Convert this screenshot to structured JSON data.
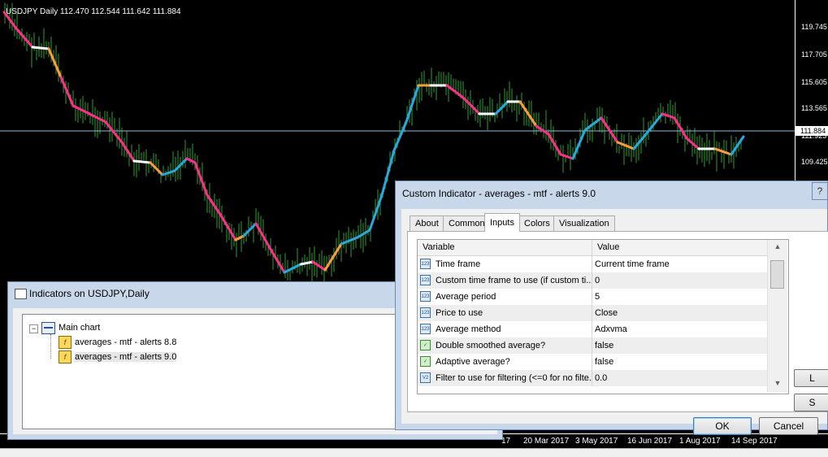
{
  "chart": {
    "title": "USDJPY Daily  112.470 112.544 111.642 111.884",
    "price_ticks": [
      "119.745",
      "117.705",
      "115.605",
      "113.565",
      "111.925",
      "109.425"
    ],
    "current_price": "111.884",
    "date_ticks": [
      "17",
      "20 Mar 2017",
      "3 May 2017",
      "16 Jun 2017",
      "1 Aug 2017",
      "14 Sep 2017"
    ],
    "colors": {
      "bars": "#2e9e2e",
      "ma_up": "#29a8e0",
      "ma_down": "#ff2d8a",
      "ma_flat": "#ffffff",
      "ma_trans": "#ff9a3c"
    }
  },
  "indicators_window": {
    "title": "Indicators on USDJPY,Daily",
    "toggle": "−",
    "main_chart": "Main chart",
    "items": [
      {
        "label": "averages - mtf - alerts  8.8"
      },
      {
        "label": "averages - mtf - alerts  9.0"
      }
    ]
  },
  "dialog": {
    "title": "Custom Indicator - averages - mtf - alerts  9.0",
    "tabs": [
      "About",
      "Common",
      "Inputs",
      "Colors",
      "Visualization"
    ],
    "active_tab": "Inputs",
    "columns": [
      "Variable",
      "Value"
    ],
    "rows": [
      {
        "icon": "123",
        "variable": "Time frame",
        "value": "Current time frame"
      },
      {
        "icon": "123",
        "variable": "Custom time frame to use (if custom ti...",
        "value": "0"
      },
      {
        "icon": "123",
        "variable": "Average period",
        "value": "5"
      },
      {
        "icon": "123",
        "variable": "Price to use",
        "value": "Close"
      },
      {
        "icon": "123",
        "variable": "Average method",
        "value": "Adxvma"
      },
      {
        "icon": "bool",
        "variable": "Double smoothed average?",
        "value": "false"
      },
      {
        "icon": "bool",
        "variable": "Adaptive average?",
        "value": "false"
      },
      {
        "icon": "V2",
        "variable": "Filter to use for filtering (<=0 for no filte...",
        "value": "0.0"
      }
    ],
    "ok_label": "OK",
    "cancel_label": "Cancel",
    "side_btn1": "L",
    "side_btn2": "S",
    "close_glyph": "?"
  }
}
